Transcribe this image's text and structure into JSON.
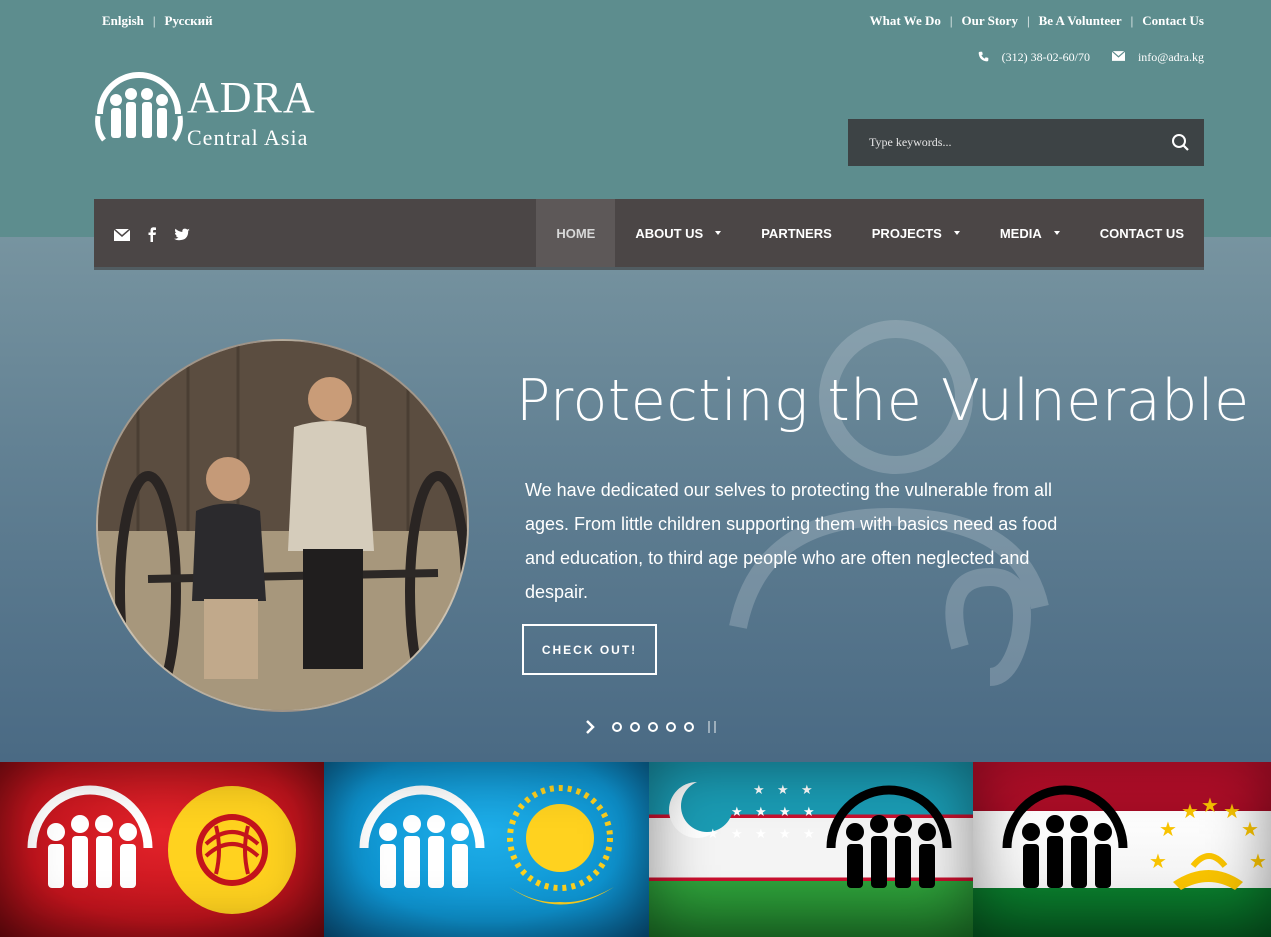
{
  "lang": {
    "english": "Enlgish",
    "russian": "Русский"
  },
  "toplinks": [
    "What We Do",
    "Our Story",
    "Be A Volunteer",
    "Contact Us"
  ],
  "contact": {
    "phone": "(312) 38-02-60/70",
    "email": "info@adra.kg",
    "phone_icon": "phone-icon",
    "email_icon": "envelope-icon"
  },
  "logo": {
    "name": "ADRA",
    "region": "Central Asia"
  },
  "search": {
    "placeholder": "Type keywords...",
    "icon": "search-icon"
  },
  "social": [
    "envelope-icon",
    "facebook-icon",
    "twitter-icon"
  ],
  "menu": [
    {
      "label": "HOME",
      "active": true,
      "dropdown": false
    },
    {
      "label": "ABOUT US",
      "active": false,
      "dropdown": true
    },
    {
      "label": "PARTNERS",
      "active": false,
      "dropdown": false
    },
    {
      "label": "PROJECTS",
      "active": false,
      "dropdown": true
    },
    {
      "label": "MEDIA",
      "active": false,
      "dropdown": true
    },
    {
      "label": "CONTACT US",
      "active": false,
      "dropdown": false
    }
  ],
  "hero": {
    "title": "Protecting the Vulnerable",
    "text": "We have dedicated our selves to protecting the vulnerable from all ages. From little children supporting them with basics need as food and education, to third age people who are often neglected and despair.",
    "button": "CHECK OUT!",
    "slides": 5
  },
  "tiles": [
    "Kyrgyzstan",
    "Kazakhstan",
    "Uzbekistan",
    "Tajikistan"
  ],
  "colors": {
    "header": "#5d8d8e",
    "nav": "#4b4646",
    "nav_active": "#5d5858",
    "search": "#3d4345"
  }
}
